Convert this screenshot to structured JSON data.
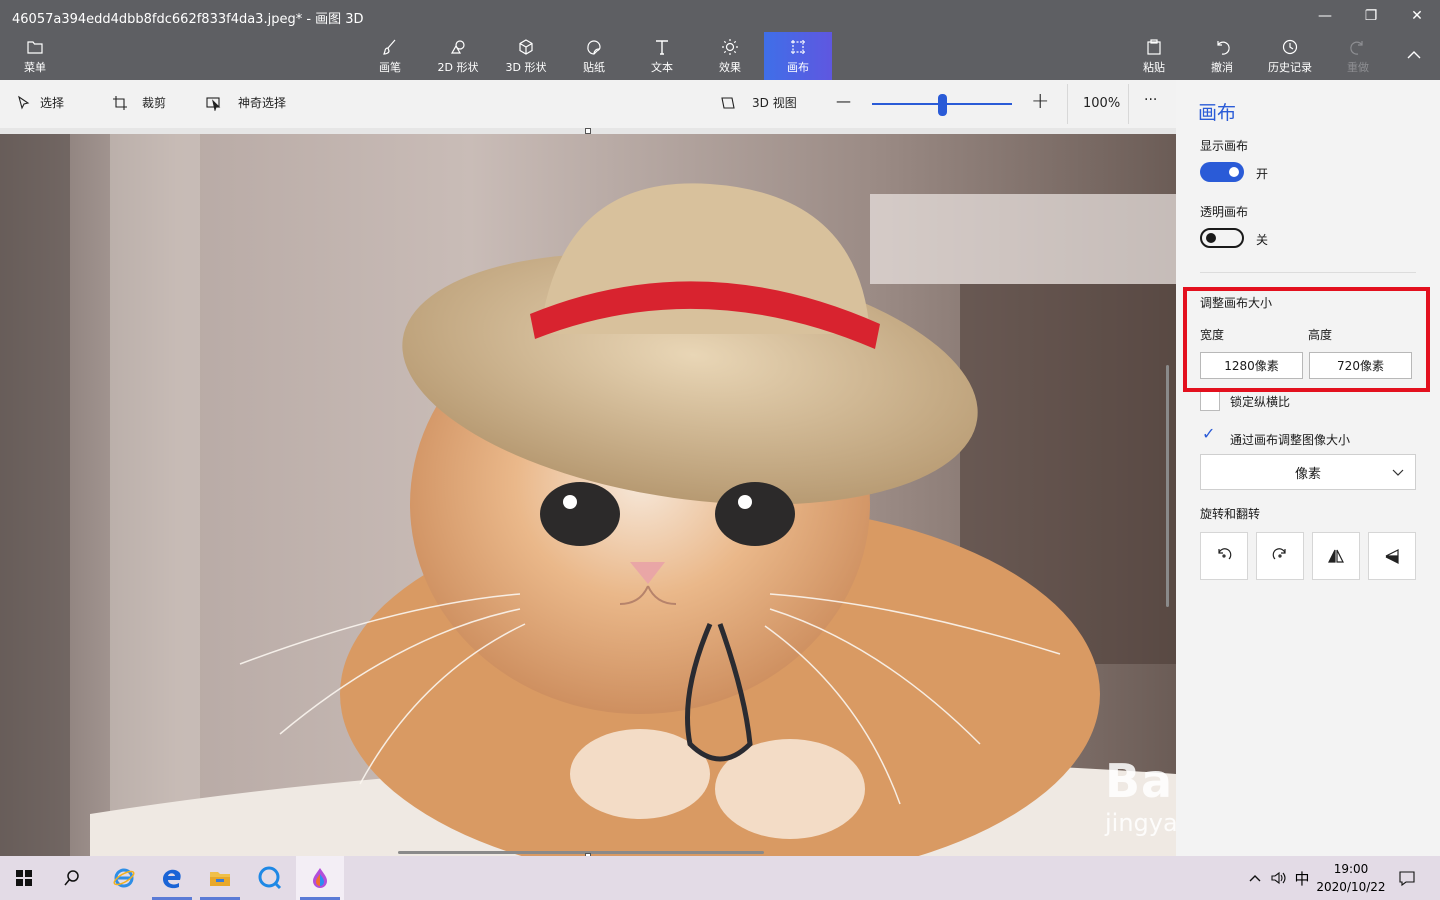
{
  "window": {
    "title": "46057a394edd4dbb8fdc662f833f4da3.jpeg* - 画图 3D",
    "minimize": "—",
    "restore": "❐",
    "close": "✕"
  },
  "ribbon": {
    "menu": "菜单",
    "brushes": "画笔",
    "shapes2d": "2D 形状",
    "shapes3d": "3D 形状",
    "stickers": "贴纸",
    "text": "文本",
    "effects": "效果",
    "canvas": "画布",
    "paste": "粘贴",
    "undo": "撤消",
    "history": "历史记录",
    "redo": "重做"
  },
  "toolbar": {
    "select": "选择",
    "crop": "裁剪",
    "magic_select": "神奇选择",
    "view3d": "3D 视图",
    "zoom_minus": "—",
    "zoom_plus": "+",
    "zoom_level": "100%",
    "zoom_fraction": 0.5,
    "more": "···"
  },
  "panel": {
    "title": "画布",
    "show_canvas_label": "显示画布",
    "show_canvas_state": "开",
    "transparent_label": "透明画布",
    "transparent_state": "关",
    "resize_label": "调整画布大小",
    "width_label": "宽度",
    "height_label": "高度",
    "width_value": "1280像素",
    "height_value": "720像素",
    "lock_aspect": "锁定纵横比",
    "resize_image": "通过画布调整图像大小",
    "unit": "像素",
    "rotate_flip": "旋转和翻转",
    "highlight_color": "#e3101e",
    "accent_color": "#2a5bd7"
  },
  "taskbar": {
    "time": "19:00",
    "date": "2020/10/22",
    "ime": "中"
  },
  "watermark": {
    "brand": "Bai du 经验",
    "url": "jingyan.baidu.com"
  }
}
